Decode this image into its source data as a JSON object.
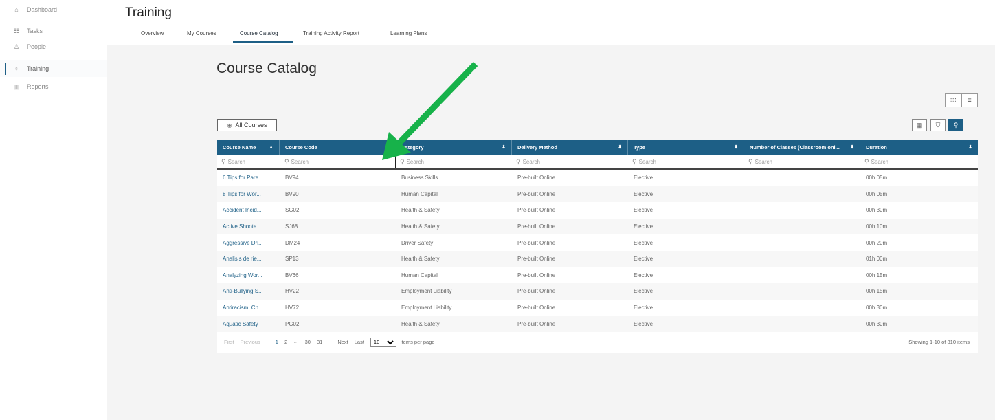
{
  "sidebar": {
    "items": [
      {
        "label": "Dashboard",
        "icon": "home-icon",
        "glyph": "⌂"
      },
      {
        "label": "Tasks",
        "icon": "tasks-icon",
        "glyph": "☷"
      },
      {
        "label": "People",
        "icon": "people-icon",
        "glyph": "♙"
      },
      {
        "label": "Training",
        "icon": "training-icon",
        "glyph": "♀"
      },
      {
        "label": "Reports",
        "icon": "reports-icon",
        "glyph": "▥"
      }
    ]
  },
  "header": {
    "title": "Training",
    "tabs": [
      "Overview",
      "My Courses",
      "Course Catalog",
      "Training Activity Report",
      "Learning Plans"
    ],
    "active_tab": "Course Catalog"
  },
  "catalog": {
    "title": "Course Catalog",
    "all_courses_label": "All Courses",
    "columns": [
      "Course Name",
      "Course Code",
      "Category",
      "Delivery Method",
      "Type",
      "Number of Classes (Classroom onl...",
      "Duration"
    ],
    "search_placeholder": "Search",
    "rows": [
      [
        "6 Tips for Pare...",
        "BV94",
        "Business Skills",
        "Pre-built Online",
        "Elective",
        "",
        "00h 05m"
      ],
      [
        "8 Tips for Wor...",
        "BV90",
        "Human Capital",
        "Pre-built Online",
        "Elective",
        "",
        "00h 05m"
      ],
      [
        "Accident Incid...",
        "SG02",
        "Health & Safety",
        "Pre-built Online",
        "Elective",
        "",
        "00h 30m"
      ],
      [
        "Active Shoote...",
        "SJ68",
        "Health & Safety",
        "Pre-built Online",
        "Elective",
        "",
        "00h 10m"
      ],
      [
        "Aggressive Dri...",
        "DM24",
        "Driver Safety",
        "Pre-built Online",
        "Elective",
        "",
        "00h 20m"
      ],
      [
        "Analisis de rie...",
        "SP13",
        "Health & Safety",
        "Pre-built Online",
        "Elective",
        "",
        "01h 00m"
      ],
      [
        "Analyzing Wor...",
        "BV66",
        "Human Capital",
        "Pre-built Online",
        "Elective",
        "",
        "00h 15m"
      ],
      [
        "Anti-Bullying S...",
        "HV22",
        "Employment Liability",
        "Pre-built Online",
        "Elective",
        "",
        "00h 15m"
      ],
      [
        "Antiracism: Ch...",
        "HV72",
        "Employment Liability",
        "Pre-built Online",
        "Elective",
        "",
        "00h 30m"
      ],
      [
        "Aquatic Safety",
        "PG02",
        "Health & Safety",
        "Pre-built Online",
        "Elective",
        "",
        "00h 30m"
      ]
    ]
  },
  "pager": {
    "first": "First",
    "previous": "Previous",
    "pages": [
      "1",
      "2",
      "···",
      "30",
      "31"
    ],
    "current": "1",
    "next": "Next",
    "last": "Last",
    "per_page": "10",
    "per_page_label": "items per page",
    "showing": "Showing 1-10 of 310 items"
  },
  "colors": {
    "accent": "#1d5f86",
    "annotation_arrow": "#17b24a"
  }
}
